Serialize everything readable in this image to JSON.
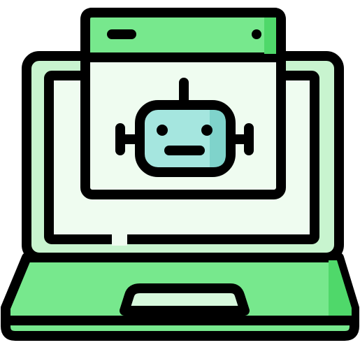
{
  "illustration": {
    "icon": "laptop-with-robot-window-icon",
    "elements": [
      "laptop-icon",
      "browser-window-icon",
      "robot-head-icon"
    ]
  },
  "colors": {
    "outline": "#000000",
    "laptop_body": "#77e88d",
    "laptop_body_shade": "#4fd86a",
    "laptop_frame": "#c8f4cf",
    "laptop_screen": "#effcf0",
    "window_titlebar": "#77e88d",
    "window_titlebar_shade": "#4fd86a",
    "window_content": "#effcf0",
    "robot_face": "#a5e6df",
    "robot_face_shade": "#7fd3cb",
    "touchpad": "#d7f7dc",
    "background_texture": "#f3f3f3"
  }
}
